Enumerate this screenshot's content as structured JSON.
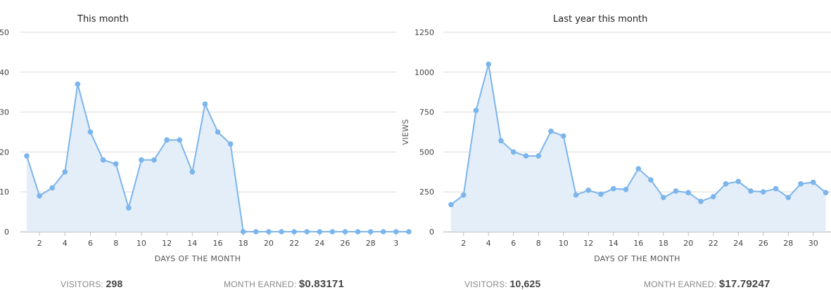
{
  "chart_data": [
    {
      "type": "area",
      "title": "This month",
      "xlabel": "DAYS OF THE MONTH",
      "ylabel": "",
      "ylim": [
        0,
        50
      ],
      "y_ticks": [
        "0",
        "10",
        "20",
        "30",
        "40",
        "50"
      ],
      "x_ticks": [
        "2",
        "4",
        "6",
        "8",
        "10",
        "12",
        "14",
        "16",
        "18",
        "20",
        "22",
        "24",
        "26",
        "28",
        "3"
      ],
      "grid": "horizontal",
      "x": [
        1,
        2,
        3,
        4,
        5,
        6,
        7,
        8,
        9,
        10,
        11,
        12,
        13,
        14,
        15,
        16,
        17,
        18,
        19,
        20,
        21,
        22,
        23,
        24,
        25,
        26,
        27,
        28,
        29,
        30,
        31
      ],
      "values": [
        19,
        9,
        11,
        15,
        37,
        25,
        18,
        17,
        6,
        18,
        18,
        23,
        23,
        15,
        32,
        25,
        22,
        0,
        0,
        0,
        0,
        0,
        0,
        0,
        0,
        0,
        0,
        0,
        0,
        0,
        0
      ]
    },
    {
      "type": "area",
      "title": "Last year this month",
      "xlabel": "DAYS OF THE MONTH",
      "ylabel": "VIEWS",
      "ylim": [
        0,
        1250
      ],
      "y_ticks": [
        "0",
        "250",
        "500",
        "750",
        "1000",
        "1250"
      ],
      "x_ticks": [
        "2",
        "4",
        "6",
        "8",
        "10",
        "12",
        "14",
        "16",
        "18",
        "20",
        "22",
        "24",
        "26",
        "28",
        "30"
      ],
      "grid": "horizontal",
      "x": [
        1,
        2,
        3,
        4,
        5,
        6,
        7,
        8,
        9,
        10,
        11,
        12,
        13,
        14,
        15,
        16,
        17,
        18,
        19,
        20,
        21,
        22,
        23,
        24,
        25,
        26,
        27,
        28,
        29,
        30,
        31
      ],
      "values": [
        170,
        230,
        760,
        1050,
        570,
        500,
        475,
        475,
        630,
        600,
        230,
        260,
        235,
        270,
        265,
        395,
        325,
        215,
        255,
        245,
        190,
        220,
        300,
        315,
        255,
        250,
        270,
        215,
        300,
        310,
        245
      ]
    }
  ],
  "stats": {
    "left": {
      "visitors_label": "VISITORS:",
      "visitors_value": "298",
      "earned_label": "MONTH EARNED:",
      "earned_value": "$0.83171"
    },
    "right": {
      "visitors_label": "VISITORS:",
      "visitors_value": "10,625",
      "earned_label": "MONTH EARNED:",
      "earned_value": "$17.79247"
    }
  },
  "colors": {
    "line": "#7cb5ec",
    "fill": "#e3eef9",
    "grid": "#d8d8d8"
  }
}
